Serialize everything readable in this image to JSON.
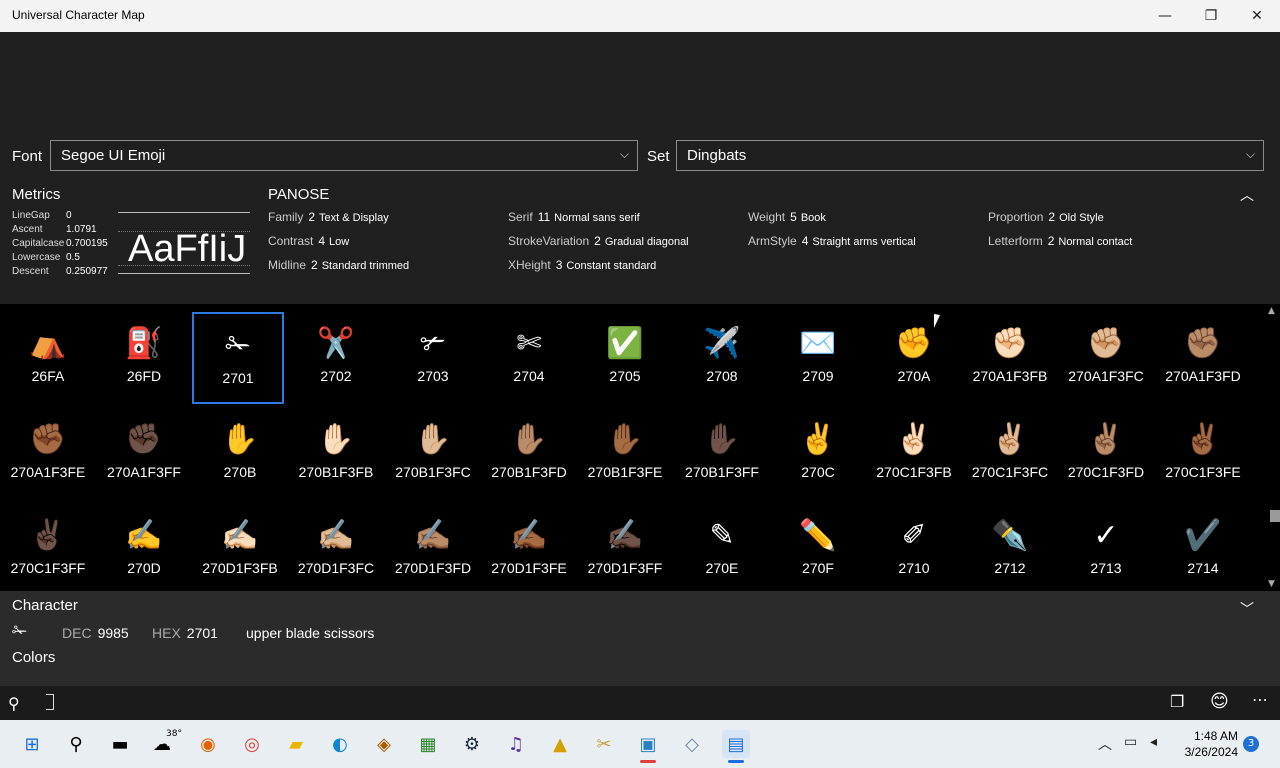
{
  "window": {
    "title": "Universal Character Map",
    "min_icon": "—",
    "max_icon": "❐",
    "close_icon": "✕"
  },
  "toolbar": {
    "font_label": "Font",
    "font_value": "Segoe UI Emoji",
    "set_label": "Set",
    "set_value": "Dingbats",
    "chevron": "⌵"
  },
  "metrics": {
    "title": "Metrics",
    "rows": [
      {
        "k": "LineGap",
        "v": "0"
      },
      {
        "k": "Ascent",
        "v": "1.0791"
      },
      {
        "k": "Capitalcase",
        "v": "0.700195"
      },
      {
        "k": "Lowercase",
        "v": "0.5"
      },
      {
        "k": "Descent",
        "v": "0.250977"
      }
    ],
    "sample": "AaFfIiJ"
  },
  "panose": {
    "title": "PANOSE",
    "items": [
      {
        "k": "Family",
        "n": "2",
        "d": "Text & Display"
      },
      {
        "k": "Contrast",
        "n": "4",
        "d": "Low"
      },
      {
        "k": "Midline",
        "n": "2",
        "d": "Standard trimmed"
      },
      {
        "k": "Serif",
        "n": "11",
        "d": "Normal sans serif"
      },
      {
        "k": "StrokeVariation",
        "n": "2",
        "d": "Gradual diagonal"
      },
      {
        "k": "XHeight",
        "n": "3",
        "d": "Constant standard"
      },
      {
        "k": "Weight",
        "n": "5",
        "d": "Book"
      },
      {
        "k": "ArmStyle",
        "n": "4",
        "d": "Straight arms vertical"
      },
      {
        "k": "Proportion",
        "n": "2",
        "d": "Old Style"
      },
      {
        "k": "Letterform",
        "n": "2",
        "d": "Normal contact"
      }
    ],
    "collapse_icon": "︿"
  },
  "grid": {
    "rows": [
      [
        {
          "g": "⛺",
          "h": "26FA"
        },
        {
          "g": "⛽",
          "h": "26FD"
        },
        {
          "g": "✁",
          "h": "2701"
        },
        {
          "g": "✂️",
          "h": "2702"
        },
        {
          "g": "✃",
          "h": "2703"
        },
        {
          "g": "✄",
          "h": "2704"
        },
        {
          "g": "✅",
          "h": "2705"
        },
        {
          "g": "✈️",
          "h": "2708"
        },
        {
          "g": "✉️",
          "h": "2709"
        },
        {
          "g": "✊",
          "h": "270A"
        },
        {
          "g": "✊🏻",
          "h": "270A1F3FB"
        },
        {
          "g": "✊🏼",
          "h": "270A1F3FC"
        },
        {
          "g": "✊🏽",
          "h": "270A1F3FD"
        }
      ],
      [
        {
          "g": "✊🏾",
          "h": "270A1F3FE"
        },
        {
          "g": "✊🏿",
          "h": "270A1F3FF"
        },
        {
          "g": "✋",
          "h": "270B"
        },
        {
          "g": "✋🏻",
          "h": "270B1F3FB"
        },
        {
          "g": "✋🏼",
          "h": "270B1F3FC"
        },
        {
          "g": "✋🏽",
          "h": "270B1F3FD"
        },
        {
          "g": "✋🏾",
          "h": "270B1F3FE"
        },
        {
          "g": "✋🏿",
          "h": "270B1F3FF"
        },
        {
          "g": "✌️",
          "h": "270C"
        },
        {
          "g": "✌🏻",
          "h": "270C1F3FB"
        },
        {
          "g": "✌🏼",
          "h": "270C1F3FC"
        },
        {
          "g": "✌🏽",
          "h": "270C1F3FD"
        },
        {
          "g": "✌🏾",
          "h": "270C1F3FE"
        }
      ],
      [
        {
          "g": "✌🏿",
          "h": "270C1F3FF"
        },
        {
          "g": "✍️",
          "h": "270D"
        },
        {
          "g": "✍🏻",
          "h": "270D1F3FB"
        },
        {
          "g": "✍🏼",
          "h": "270D1F3FC"
        },
        {
          "g": "✍🏽",
          "h": "270D1F3FD"
        },
        {
          "g": "✍🏾",
          "h": "270D1F3FE"
        },
        {
          "g": "✍🏿",
          "h": "270D1F3FF"
        },
        {
          "g": "✎",
          "h": "270E"
        },
        {
          "g": "✏️",
          "h": "270F"
        },
        {
          "g": "✐",
          "h": "2710"
        },
        {
          "g": "✒️",
          "h": "2712"
        },
        {
          "g": "✓",
          "h": "2713"
        },
        {
          "g": "✔️",
          "h": "2714"
        }
      ]
    ],
    "selected": "2701"
  },
  "character": {
    "title": "Character",
    "glyph": "✁",
    "dec_label": "DEC",
    "dec_value": "9985",
    "hex_label": "HEX",
    "hex_value": "2701",
    "name": "upper blade scissors",
    "colors_label": "Colors",
    "expand_icon": "﹀"
  },
  "bottombar": {
    "search_icon": "⚲",
    "copy_icon": "❐",
    "emoji_icon": "😊",
    "more_icon": "⋯"
  },
  "taskbar": {
    "start_icon": "⊞",
    "search_icon": "⚲",
    "temp": "38°",
    "apps": [
      "taskview",
      "weather",
      "firefox",
      "chrome",
      "files",
      "edge",
      "eye",
      "terminal",
      "steam",
      "headphones",
      "unknown-app",
      "kitchen",
      "monitor",
      "map",
      "ucm"
    ],
    "clock_time": "1:48 AM",
    "clock_date": "3/26/2024",
    "notifications": "3",
    "tray_chevron": "︿"
  }
}
